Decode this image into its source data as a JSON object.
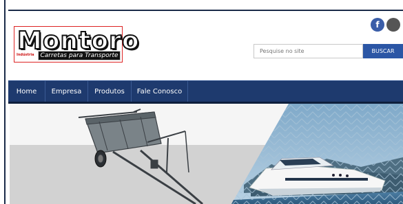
{
  "brand": {
    "logo_word": "Montoro",
    "logo_small": "Indústria",
    "logo_tagline": "Carretas para Transporte"
  },
  "social": {
    "facebook_glyph": "f"
  },
  "search": {
    "placeholder": "Pesquise no site",
    "button_label": "BUSCAR"
  },
  "nav": {
    "items": [
      "Home",
      "Empresa",
      "Produtos",
      "Fale Conosco"
    ]
  },
  "colors": {
    "nav_bg": "#1e3a6e",
    "search_button": "#2b56a5",
    "facebook": "#3a5da8"
  }
}
